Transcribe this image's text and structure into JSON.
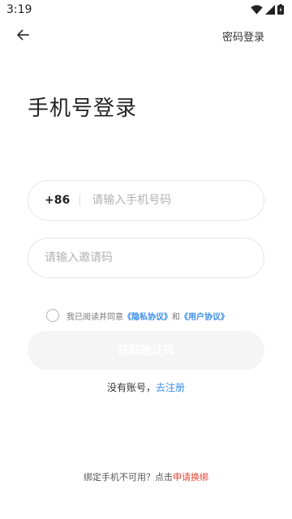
{
  "status_bar": {
    "time": "3:19",
    "icons": [
      "wifi-icon",
      "signal-icon",
      "battery-icon"
    ]
  },
  "header": {
    "back_icon": "back-arrow-icon",
    "password_login_label": "密码登录"
  },
  "page": {
    "title": "手机号登录"
  },
  "phone": {
    "country_code": "+86",
    "placeholder": "请输入手机号码",
    "value": ""
  },
  "invite": {
    "placeholder": "请输入邀请码",
    "value": ""
  },
  "agreement": {
    "checked": false,
    "prefix": "我已阅读并同意",
    "privacy_link": "《隐私协议》",
    "connector": "和",
    "user_link": "《用户协议》"
  },
  "actions": {
    "get_code_label": "获取验证码"
  },
  "register": {
    "prompt": "没有账号，",
    "link": "去注册"
  },
  "footer": {
    "prompt": "绑定手机不可用？点击",
    "link": "申请换绑"
  },
  "colors": {
    "accent_blue": "#3b8ee8",
    "warning_red": "#e0442f",
    "disabled_button": "#f5f5f5",
    "border": "#e6e6e6"
  }
}
